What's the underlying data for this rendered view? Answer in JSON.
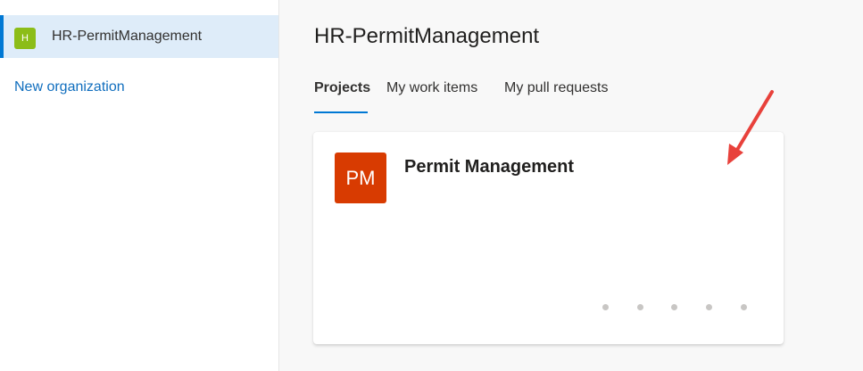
{
  "sidebar": {
    "organization": {
      "avatar_letter": "H",
      "avatar_color": "#8cbd18",
      "name": "HR-PermitManagement"
    },
    "new_org_label": "New organization"
  },
  "main": {
    "title": "HR-PermitManagement",
    "tabs": [
      {
        "label": "Projects",
        "selected": true
      },
      {
        "label": "My work items",
        "selected": false
      },
      {
        "label": "My pull requests",
        "selected": false
      }
    ],
    "project_card": {
      "initials": "PM",
      "avatar_color": "#d83b01",
      "name": "Permit Management"
    }
  },
  "colors": {
    "accent": "#0078d4",
    "link": "#106ebe",
    "selected_bg": "#deecf9",
    "annotation_arrow": "#e8413b"
  },
  "icons": {
    "annotation": "arrow-icon"
  }
}
